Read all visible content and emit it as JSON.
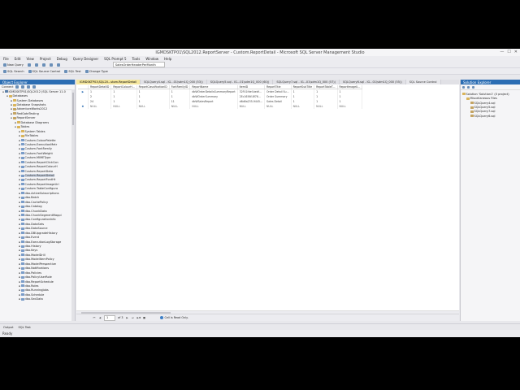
{
  "window": {
    "title": "IGMDSKTP01\\SQL2012.ReportServer - Custom.ReportDetail - Microsoft SQL Server Management Studio",
    "controls": [
      "—",
      "☐",
      "✕"
    ]
  },
  "menu": [
    "File",
    "Edit",
    "View",
    "Project",
    "Debug",
    "Query Designer",
    "SQL Prompt 5",
    "Tools",
    "Window",
    "Help"
  ],
  "toolbar": {
    "row1": [
      "New Query",
      "",
      "",
      "",
      "",
      ""
    ],
    "row2": [
      "SQL Search",
      "SQL Source Control",
      "SQL Test",
      "Change Type"
    ],
    "combo_value": "SalesOrderHeaderPerMonth"
  },
  "object_explorer": {
    "title": "Object Explorer",
    "toolbar": [
      "Connect",
      "",
      "",
      "",
      ""
    ],
    "nodes": [
      {
        "label": "IGMDSKTP01\\SQL2012 (SQL Server 11.0",
        "indent": 0,
        "icon": "server",
        "exp": "⊟"
      },
      {
        "label": "Databases",
        "indent": 1,
        "icon": "folder",
        "exp": "⊟"
      },
      {
        "label": "System Databases",
        "indent": 2,
        "icon": "folder",
        "exp": "⊞"
      },
      {
        "label": "Database Snapshots",
        "indent": 2,
        "icon": "folder",
        "exp": "⊞"
      },
      {
        "label": "AdventureWorks2012",
        "indent": 2,
        "icon": "db",
        "exp": "⊞"
      },
      {
        "label": "RedGateTesting",
        "indent": 2,
        "icon": "db",
        "exp": "⊞"
      },
      {
        "label": "ReportServer",
        "indent": 2,
        "icon": "db",
        "exp": "⊟"
      },
      {
        "label": "Database Diagrams",
        "indent": 3,
        "icon": "folder",
        "exp": "⊞"
      },
      {
        "label": "Tables",
        "indent": 3,
        "icon": "folder",
        "exp": "⊟"
      },
      {
        "label": "System Tables",
        "indent": 4,
        "icon": "folder",
        "exp": "⊞"
      },
      {
        "label": "FileTables",
        "indent": 4,
        "icon": "folder",
        "exp": "⊞"
      },
      {
        "label": "Custom.ColourPalette",
        "indent": 4,
        "icon": "table",
        "exp": "⊞"
      },
      {
        "label": "Custom.ExecutionMetr",
        "indent": 4,
        "icon": "table",
        "exp": "⊞"
      },
      {
        "label": "Custom.FontFamily",
        "indent": 4,
        "icon": "table",
        "exp": "⊞"
      },
      {
        "label": "Custom.FontWeight",
        "indent": 4,
        "icon": "table",
        "exp": "⊞"
      },
      {
        "label": "Custom.MIMEType",
        "indent": 4,
        "icon": "table",
        "exp": "⊞"
      },
      {
        "label": "Custom.ReportClickCon",
        "indent": 4,
        "icon": "table",
        "exp": "⊞"
      },
      {
        "label": "Custom.ReportColourH",
        "indent": 4,
        "icon": "table",
        "exp": "⊞"
      },
      {
        "label": "Custom.ReportData",
        "indent": 4,
        "icon": "table",
        "exp": "⊞"
      },
      {
        "label": "Custom.ReportDetail",
        "indent": 4,
        "icon": "table",
        "exp": "⊞",
        "selected": true
      },
      {
        "label": "Custom.ReportFontHt",
        "indent": 4,
        "icon": "table",
        "exp": "⊞"
      },
      {
        "label": "Custom.ReportImageUrl",
        "indent": 4,
        "icon": "table",
        "exp": "⊞"
      },
      {
        "label": "Custom.TableConfigura",
        "indent": 4,
        "icon": "table",
        "exp": "⊞"
      },
      {
        "label": "dbo.ActiveSubscriptions",
        "indent": 4,
        "icon": "table",
        "exp": "⊞"
      },
      {
        "label": "dbo.Batch",
        "indent": 4,
        "icon": "table",
        "exp": "⊞"
      },
      {
        "label": "dbo.CachePolicy",
        "indent": 4,
        "icon": "table",
        "exp": "⊞"
      },
      {
        "label": "dbo.Catalog",
        "indent": 4,
        "icon": "table",
        "exp": "⊞"
      },
      {
        "label": "dbo.ChunkData",
        "indent": 4,
        "icon": "table",
        "exp": "⊞"
      },
      {
        "label": "dbo.ChunkSegmentMappi",
        "indent": 4,
        "icon": "table",
        "exp": "⊞"
      },
      {
        "label": "dbo.ConfigurationInfo",
        "indent": 4,
        "icon": "table",
        "exp": "⊞"
      },
      {
        "label": "dbo.DataSets",
        "indent": 4,
        "icon": "table",
        "exp": "⊞"
      },
      {
        "label": "dbo.DataSource",
        "indent": 4,
        "icon": "table",
        "exp": "⊞"
      },
      {
        "label": "dbo.DBUpgradeHistory",
        "indent": 4,
        "icon": "table",
        "exp": "⊞"
      },
      {
        "label": "dbo.Event",
        "indent": 4,
        "icon": "table",
        "exp": "⊞"
      },
      {
        "label": "dbo.ExecutionLogStorage",
        "indent": 4,
        "icon": "table",
        "exp": "⊞"
      },
      {
        "label": "dbo.History",
        "indent": 4,
        "icon": "table",
        "exp": "⊞"
      },
      {
        "label": "dbo.Keys",
        "indent": 4,
        "icon": "table",
        "exp": "⊞"
      },
      {
        "label": "dbo.ModelDrill",
        "indent": 4,
        "icon": "table",
        "exp": "⊞"
      },
      {
        "label": "dbo.ModelItemPolicy",
        "indent": 4,
        "icon": "table",
        "exp": "⊞"
      },
      {
        "label": "dbo.ModelPerspective",
        "indent": 4,
        "icon": "table",
        "exp": "⊞"
      },
      {
        "label": "dbo.Notifications",
        "indent": 4,
        "icon": "table",
        "exp": "⊞"
      },
      {
        "label": "dbo.Policies",
        "indent": 4,
        "icon": "table",
        "exp": "⊞"
      },
      {
        "label": "dbo.PolicyUserRole",
        "indent": 4,
        "icon": "table",
        "exp": "⊞"
      },
      {
        "label": "dbo.ReportSchedule",
        "indent": 4,
        "icon": "table",
        "exp": "⊞"
      },
      {
        "label": "dbo.Roles",
        "indent": 4,
        "icon": "table",
        "exp": "⊞"
      },
      {
        "label": "dbo.RunningJobs",
        "indent": 4,
        "icon": "table",
        "exp": "⊞"
      },
      {
        "label": "dbo.Schedule",
        "indent": 4,
        "icon": "table",
        "exp": "⊞"
      },
      {
        "label": "dbo.SecData",
        "indent": 4,
        "icon": "table",
        "exp": "⊞"
      }
    ]
  },
  "tabs": [
    {
      "label": "IGMDSKTP01\\SQL20...stom.ReportDetail",
      "active": true
    },
    {
      "label": "SQLQuery4.sql - IG...01\\sdm1Q_000 (53))",
      "active": false
    },
    {
      "label": "SQLQuery5.sql - IG...01\\sdm1Q_000 (60))",
      "active": false
    },
    {
      "label": "SQLQuery7.sql - IG...01\\sdm1Q_000 (57))",
      "active": false
    },
    {
      "label": "SQLQuery6.sql - IG...01\\sdm1Q_000 (55))",
      "active": false
    },
    {
      "label": "SQL Source Control",
      "active": false
    }
  ],
  "grid": {
    "headers": [
      "ReportDetailID",
      "ReportColourH...",
      "ReportClassificationID",
      "FontFamilyID",
      "ReportName",
      "ItemID",
      "ReportTitle",
      "ReportSubTitle",
      "ReportTableT...",
      "ReportImageU..."
    ],
    "rows": [
      {
        "marker": "▶",
        "cells": [
          "1",
          "1",
          "1",
          "1",
          "dbWOrderDetailsSummaryReport",
          "32F41fdef-bebf...",
          "Order Detail Su...",
          "1",
          "1",
          "1"
        ]
      },
      {
        "marker": "",
        "cells": [
          "2",
          "1",
          "1",
          "1",
          "dbWOrderSummary",
          "2Ec1656f-8f76...",
          "Order Summary",
          "1",
          "1",
          "1"
        ]
      },
      {
        "marker": "",
        "cells": [
          "24",
          "1",
          "1",
          "11",
          "dbWSalesReport",
          "d6d6a235-9445...",
          "Sales Detail",
          "1",
          "1",
          "1"
        ]
      },
      {
        "marker": "✱",
        "cells": [
          "NULL",
          "NULL",
          "NULL",
          "NULL",
          "NULL",
          "NULL",
          "NULL",
          "NULL",
          "NULL",
          "NULL"
        ],
        "new": true
      }
    ]
  },
  "navigator": {
    "first": "⏮",
    "prev": "◀",
    "position": "1",
    "of_text": "of 3",
    "next": "▶",
    "last": "⏭",
    "new": "▶✱",
    "stop": "■",
    "status": "Cell is Read Only."
  },
  "solution_explorer": {
    "title": "Solution Explorer",
    "nodes": [
      {
        "label": "Solution 'Solution1' (0 project)",
        "indent": 0,
        "icon": "folder"
      },
      {
        "label": "Miscellaneous Files",
        "indent": 1,
        "icon": "folder"
      },
      {
        "label": "SQLQuery4.sql",
        "indent": 2,
        "icon": "db"
      },
      {
        "label": "SQLQuery5.sql",
        "indent": 2,
        "icon": "db"
      },
      {
        "label": "SQLQuery7.sql",
        "indent": 2,
        "icon": "db"
      },
      {
        "label": "SQLQuery6.sql",
        "indent": 2,
        "icon": "db"
      }
    ]
  },
  "bottom_tabs": [
    "Output",
    "SQL Test"
  ],
  "status": "Ready"
}
